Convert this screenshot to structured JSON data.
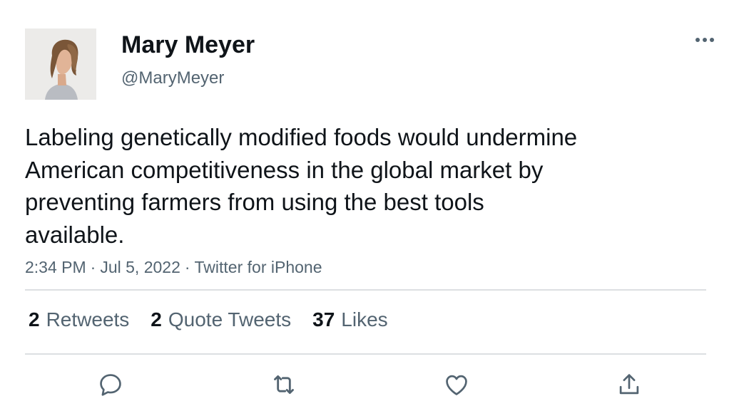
{
  "user": {
    "display_name": "Mary Meyer",
    "handle": "@MaryMeyer",
    "avatar_icon": "profile-photo"
  },
  "tweet": {
    "text": "Labeling genetically modified foods would undermine\nAmerican competitiveness in the global market by\npreventing farmers from using the best tools\navailable.",
    "time": "2:34 PM",
    "date": "Jul 5, 2022",
    "source": "Twitter for iPhone",
    "separator": "·"
  },
  "stats": {
    "retweets_count": "2",
    "retweets_label": "Retweets",
    "quotes_count": "2",
    "quotes_label": "Quote Tweets",
    "likes_count": "37",
    "likes_label": "Likes"
  },
  "icons": {
    "more": "more-horizontal-icon",
    "reply": "reply-icon",
    "retweet": "retweet-icon",
    "like": "heart-icon",
    "share": "share-icon"
  },
  "colors": {
    "text": "#0f1419",
    "secondary_text": "#536471",
    "divider": "#dcdfe2",
    "background": "#ffffff"
  }
}
